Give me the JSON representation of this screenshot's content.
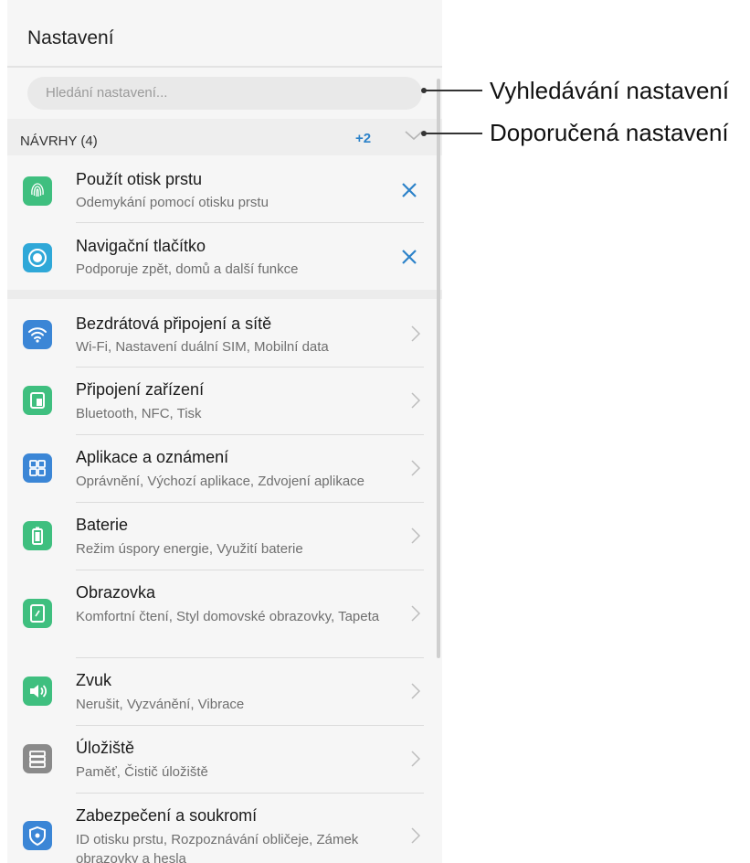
{
  "header": {
    "title": "Nastavení"
  },
  "search": {
    "placeholder": "Hledání nastavení..."
  },
  "suggestions": {
    "title": "NÁVRHY (4)",
    "more_count": "+2",
    "items": [
      {
        "title": "Použít otisk prstu",
        "subtitle": "Odemykání pomocí otisku prstu",
        "icon": "fingerprint-icon",
        "color": "#3fbf7f"
      },
      {
        "title": "Navigační tlačítko",
        "subtitle": "Podporuje zpět, domů a další funkce",
        "icon": "nav-dock-icon",
        "color": "#2fa8d8"
      }
    ]
  },
  "settings": {
    "items": [
      {
        "title": "Bezdrátová připojení a sítě",
        "subtitle": "Wi-Fi, Nastavení duální SIM, Mobilní data",
        "icon": "wifi-icon",
        "color": "#3b86d6"
      },
      {
        "title": "Připojení zařízení",
        "subtitle": "Bluetooth, NFC, Tisk",
        "icon": "device-connection-icon",
        "color": "#3fbf7f"
      },
      {
        "title": "Aplikace a oznámení",
        "subtitle": "Oprávnění, Výchozí aplikace, Zdvojení aplikace",
        "icon": "apps-icon",
        "color": "#3b86d6"
      },
      {
        "title": "Baterie",
        "subtitle": "Režim úspory energie, Využití baterie",
        "icon": "battery-icon",
        "color": "#3fbf7f"
      },
      {
        "title": "Obrazovka",
        "subtitle": "Komfortní čtení, Styl domovské obrazovky, Tapeta",
        "icon": "display-icon",
        "color": "#3fbf7f"
      },
      {
        "title": "Zvuk",
        "subtitle": "Nerušit, Vyzvánění, Vibrace",
        "icon": "sound-icon",
        "color": "#3fbf7f"
      },
      {
        "title": "Úložiště",
        "subtitle": "Paměť, Čistič úložiště",
        "icon": "storage-icon",
        "color": "#8a8a8a"
      },
      {
        "title": "Zabezpečení a soukromí",
        "subtitle": "ID otisku prstu, Rozpoznávání obličeje, Zámek obrazovky a hesla",
        "icon": "security-shield-icon",
        "color": "#3b86d6"
      }
    ]
  },
  "callouts": {
    "search": "Vyhledávání nastavení",
    "suggested": "Doporučená nastavení"
  },
  "colors": {
    "accent": "#2c82c9",
    "background": "#f6f6f6"
  }
}
